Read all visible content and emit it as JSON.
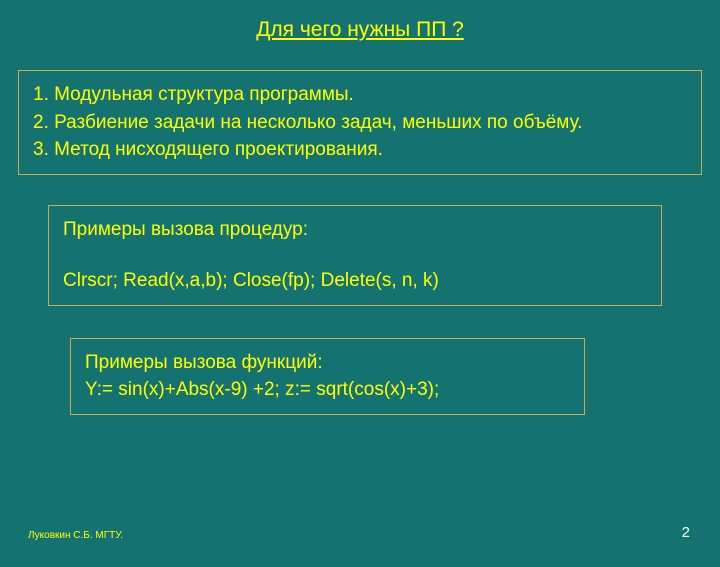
{
  "title": "Для чего нужны  ПП ?",
  "list": {
    "item1": "1. Модульная структура программы.",
    "item2": "2. Разбиение задачи на несколько задач, меньших по объёму.",
    "item3": "3. Метод нисходящего проектирования."
  },
  "procedures": {
    "heading": "Примеры вызова процедур:",
    "code": "Clrscr;     Read(x,a,b);   Close(fp);  Delete(s, n, k)"
  },
  "functions": {
    "heading": "Примеры вызова функций:",
    "code": "Y:= sin(x)+Abs(x-9) +2;    z:= sqrt(cos(x)+3);"
  },
  "footer": {
    "author": "Луковкин С.Б. МГТУ.",
    "page": "2"
  }
}
